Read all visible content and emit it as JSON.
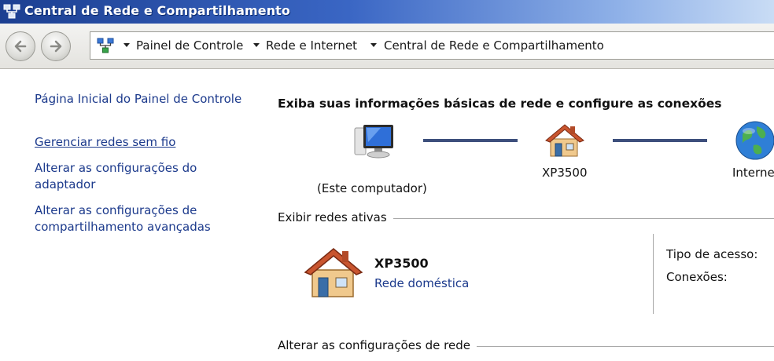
{
  "window": {
    "title": "Central de Rede e Compartilhamento"
  },
  "address": {
    "breadcrumbs": [
      "Painel de Controle",
      "Rede e Internet",
      "Central de Rede e Compartilhamento"
    ]
  },
  "sidebar": {
    "home_link": "Página Inicial do Painel de Controle",
    "links": [
      {
        "label": "Gerenciar redes sem fio"
      },
      {
        "line1": "Alterar as configurações do",
        "line2": "adaptador"
      },
      {
        "line1": "Alterar as configurações de",
        "line2": "compartilhamento avançadas"
      }
    ]
  },
  "main": {
    "heading": "Exiba suas informações básicas de rede e configure as conexões",
    "map": {
      "computer_label": "(Este computador)",
      "network_label": "XP3500",
      "internet_label": "Interne"
    },
    "active_section_label": "Exibir redes ativas",
    "active_network": {
      "name": "XP3500",
      "type": "Rede doméstica",
      "access_type_label": "Tipo de acesso:",
      "connections_label": "Conexões:"
    },
    "change_section_label": "Alterar as configurações de rede"
  },
  "icons": {
    "title": "network-center-icon",
    "back": "back-arrow-icon",
    "forward": "forward-arrow-icon",
    "address": "network-center-icon",
    "computer": "computer-icon",
    "house": "house-icon",
    "globe": "globe-icon"
  },
  "colors": {
    "link": "#1c3a8c",
    "titlebar": "#2a54b0",
    "connection_line": "#3d4f7c"
  }
}
